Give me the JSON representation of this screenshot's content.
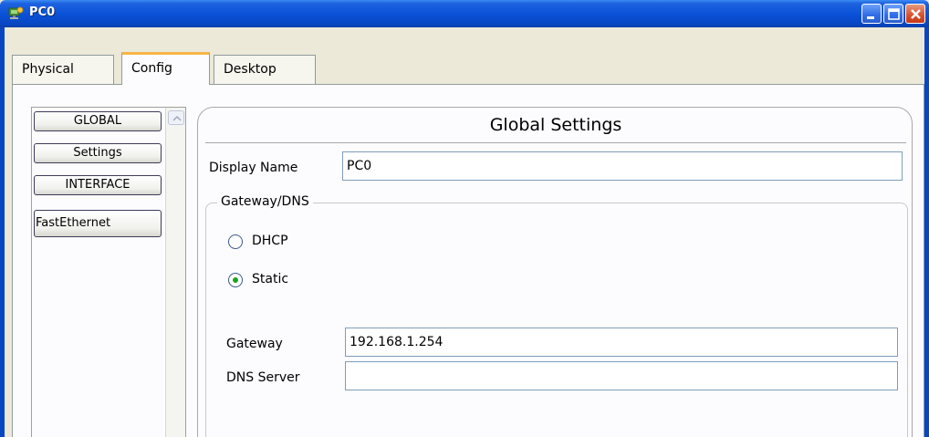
{
  "window": {
    "title": "PC0"
  },
  "tabs": [
    {
      "label": "Physical"
    },
    {
      "label": "Config"
    },
    {
      "label": "Desktop"
    }
  ],
  "active_tab": "Config",
  "nav": {
    "items": [
      {
        "label": "GLOBAL"
      },
      {
        "label": "Settings"
      },
      {
        "label": "INTERFACE"
      },
      {
        "label": "FastEthernet"
      }
    ]
  },
  "settings": {
    "title": "Global Settings",
    "display_name_label": "Display Name",
    "display_name_value": "PC0",
    "gateway_dns": {
      "legend": "Gateway/DNS",
      "dhcp_label": "DHCP",
      "static_label": "Static",
      "selected": "Static",
      "gateway_label": "Gateway",
      "gateway_value": "192.168.1.254",
      "dns_label": "DNS Server",
      "dns_value": ""
    }
  },
  "colors": {
    "titlebar": "#0A52D8",
    "active_tab_accent": "#F7B54A",
    "radio_selected": "#21A121",
    "close_button": "#D6502D"
  }
}
